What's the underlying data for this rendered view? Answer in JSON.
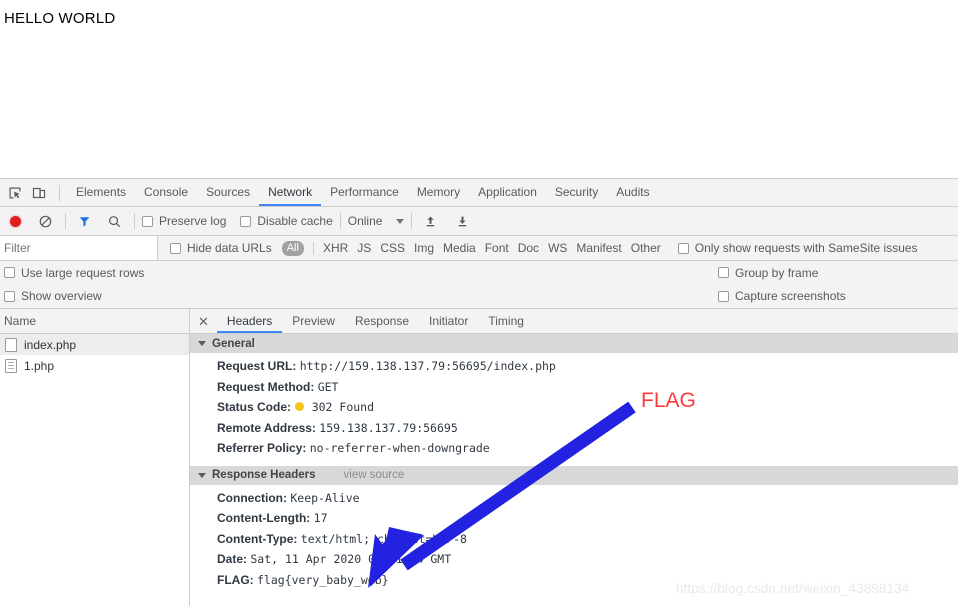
{
  "page": {
    "heading": "HELLO WORLD"
  },
  "devtools": {
    "icons": {
      "inspect": "inspect-element-icon",
      "device": "device-toolbar-icon",
      "record": "record-icon",
      "clear": "clear-icon",
      "filter": "filter-icon",
      "search": "search-icon",
      "import": "import-har-icon",
      "export": "export-har-icon"
    },
    "main_tabs": [
      {
        "label": "Elements",
        "active": false
      },
      {
        "label": "Console",
        "active": false
      },
      {
        "label": "Sources",
        "active": false
      },
      {
        "label": "Network",
        "active": true
      },
      {
        "label": "Performance",
        "active": false
      },
      {
        "label": "Memory",
        "active": false
      },
      {
        "label": "Application",
        "active": false
      },
      {
        "label": "Security",
        "active": false
      },
      {
        "label": "Audits",
        "active": false
      }
    ],
    "network_toolbar": {
      "preserve_log_label": "Preserve log",
      "preserve_log_checked": false,
      "disable_cache_label": "Disable cache",
      "disable_cache_checked": false,
      "throttling_value": "Online"
    },
    "filter_row": {
      "filter_placeholder": "Filter",
      "filter_value": "",
      "hide_data_urls_label": "Hide data URLs",
      "hide_data_urls_checked": false,
      "types": [
        "All",
        "XHR",
        "JS",
        "CSS",
        "Img",
        "Media",
        "Font",
        "Doc",
        "WS",
        "Manifest",
        "Other"
      ],
      "active_type": "All",
      "samesite_label": "Only show requests with SameSite issues",
      "samesite_checked": false
    },
    "options": {
      "use_large_request_rows_label": "Use large request rows",
      "use_large_request_rows_checked": false,
      "show_overview_label": "Show overview",
      "show_overview_checked": false,
      "group_by_frame_label": "Group by frame",
      "group_by_frame_checked": false,
      "capture_screenshots_label": "Capture screenshots",
      "capture_screenshots_checked": false
    },
    "request_list": {
      "column_header": "Name",
      "rows": [
        {
          "name": "index.php",
          "icon": "blank-document-icon",
          "selected": true
        },
        {
          "name": "1.php",
          "icon": "text-document-icon",
          "selected": false
        }
      ]
    },
    "detail_tabs": [
      {
        "label": "Headers",
        "active": true
      },
      {
        "label": "Preview",
        "active": false
      },
      {
        "label": "Response",
        "active": false
      },
      {
        "label": "Initiator",
        "active": false
      },
      {
        "label": "Timing",
        "active": false
      }
    ],
    "general_section": {
      "title": "General",
      "rows": [
        {
          "key": "Request URL:",
          "value": "http://159.138.137.79:56695/index.php",
          "dot": false
        },
        {
          "key": "Request Method:",
          "value": "GET",
          "dot": false
        },
        {
          "key": "Status Code:",
          "value": "302 Found",
          "dot": true,
          "dot_color": "#f5c518"
        },
        {
          "key": "Remote Address:",
          "value": "159.138.137.79:56695",
          "dot": false
        },
        {
          "key": "Referrer Policy:",
          "value": "no-referrer-when-downgrade",
          "dot": false
        }
      ]
    },
    "response_headers_section": {
      "title": "Response Headers",
      "view_source_label": "view source",
      "rows": [
        {
          "key": "Connection:",
          "value": "Keep-Alive"
        },
        {
          "key": "Content-Length:",
          "value": "17"
        },
        {
          "key": "Content-Type:",
          "value": "text/html; charset=UTF-8"
        },
        {
          "key": "Date:",
          "value": "Sat, 11 Apr 2020 07:21:34 GMT"
        },
        {
          "key": "FLAG:",
          "value": "flag{very_baby_web}"
        }
      ]
    }
  },
  "annotation": {
    "flag_label": "FLAG",
    "flag_color": "#fc3c3c",
    "arrow_color": "#2222e0",
    "watermark": "https://blog.csdn.net/weixin_43898134"
  }
}
